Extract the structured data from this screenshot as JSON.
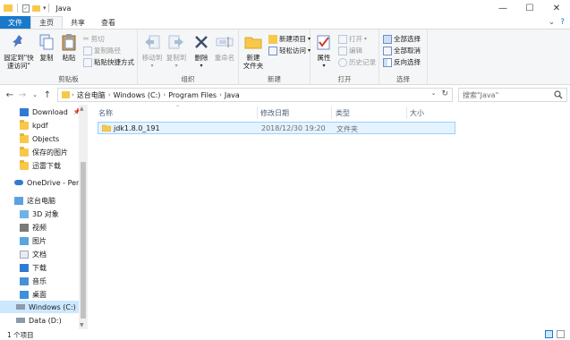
{
  "window": {
    "title": "Java",
    "controls": {
      "minimize": "—",
      "maximize": "☐",
      "close": "✕"
    }
  },
  "ribbon_tabs": [
    "文件",
    "主页",
    "共享",
    "查看"
  ],
  "ribbon": {
    "clipboard": {
      "pin_label": "固定到\"快\n速访问\"",
      "copy_label": "复制",
      "paste_label": "粘贴",
      "cut_label": "剪切",
      "copy_path_label": "复制路径",
      "paste_shortcut_label": "粘贴快捷方式",
      "group_label": "剪贴板"
    },
    "organize": {
      "move_to_label": "移动到",
      "copy_to_label": "复制到",
      "delete_label": "删除",
      "rename_label": "重命名",
      "group_label": "组织"
    },
    "new": {
      "new_folder_label": "新建\n文件夹",
      "new_item_label": "新建项目",
      "easy_access_label": "轻松访问",
      "group_label": "新建"
    },
    "open": {
      "properties_label": "属性",
      "open_label": "打开",
      "edit_label": "编辑",
      "history_label": "历史记录",
      "group_label": "打开"
    },
    "select": {
      "select_all_label": "全部选择",
      "select_none_label": "全部取消",
      "invert_label": "反向选择",
      "group_label": "选择"
    }
  },
  "address": {
    "crumbs": [
      "这台电脑",
      "Windows (C:)",
      "Program Files",
      "Java"
    ],
    "search_placeholder": "搜索\"Java\""
  },
  "nav_pane": {
    "quick_access": [
      {
        "label": "Download",
        "pinned": true
      },
      {
        "label": "kpdf",
        "pinned": false
      },
      {
        "label": "Objects",
        "pinned": false
      },
      {
        "label": "保存的图片",
        "pinned": false
      },
      {
        "label": "迅雷下载",
        "pinned": false
      }
    ],
    "onedrive": "OneDrive - Perso",
    "this_pc": "这台电脑",
    "pc_items": [
      "3D 对象",
      "视频",
      "图片",
      "文档",
      "下载",
      "音乐",
      "桌面"
    ],
    "drives": [
      "Windows (C:)",
      "Data (D:)"
    ]
  },
  "columns": {
    "name": "名称",
    "modified": "修改日期",
    "type": "类型",
    "size": "大小"
  },
  "files": [
    {
      "name": "jdk1.8.0_191",
      "modified": "2018/12/30 19:20",
      "type": "文件夹",
      "size": ""
    }
  ],
  "status": {
    "item_count": "1 个项目"
  },
  "colors": {
    "accent": "#1979ca",
    "selection": "#cce8ff",
    "folder": "#f7c84a"
  }
}
